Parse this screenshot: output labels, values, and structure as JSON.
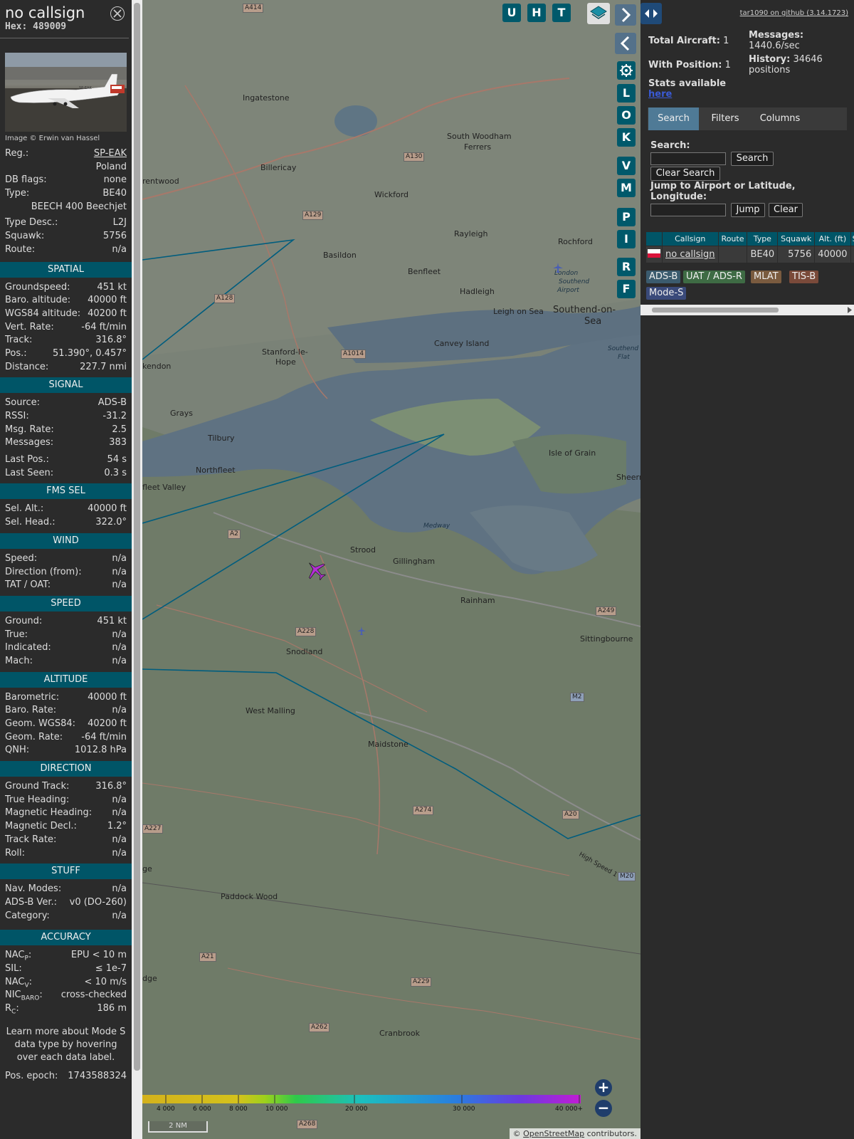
{
  "sidebar": {
    "callsign": "no callsign",
    "hex": "Hex: 489009",
    "photo_credit": "Image © Erwin van Hassel",
    "photo_reg": "SP-EAK",
    "info": [
      {
        "k": "Reg.:",
        "v": "SP-EAK",
        "link": true
      },
      {
        "k": "",
        "v": "Poland"
      },
      {
        "k": "DB flags:",
        "v": "none"
      },
      {
        "k": "Type:",
        "v": "BE40"
      },
      {
        "k": "",
        "v": "BEECH 400 Beechjet"
      },
      {
        "k": "Type Desc.:",
        "v": "L2J"
      },
      {
        "k": "Squawk:",
        "v": "5756"
      },
      {
        "k": "Route:",
        "v": "n/a"
      }
    ],
    "sections": [
      {
        "title": "SPATIAL",
        "rows": [
          {
            "k": "Groundspeed:",
            "v": "451 kt"
          },
          {
            "k": "Baro. altitude:",
            "v": "40000 ft"
          },
          {
            "k": "WGS84 altitude:",
            "v": "40200 ft"
          },
          {
            "k": "Vert. Rate:",
            "v": "-64 ft/min"
          },
          {
            "k": "Track:",
            "v": "316.8°"
          },
          {
            "k": "Pos.:",
            "v": "51.390°, 0.457°"
          },
          {
            "k": "Distance:",
            "v": "227.7 nmi"
          }
        ]
      },
      {
        "title": "SIGNAL",
        "rows": [
          {
            "k": "Source:",
            "v": "ADS-B"
          },
          {
            "k": "RSSI:",
            "v": "-31.2"
          },
          {
            "k": "Msg. Rate:",
            "v": "2.5"
          },
          {
            "k": "Messages:",
            "v": "383"
          },
          {
            "k": "Last Pos.:",
            "v": "54 s",
            "gap": true
          },
          {
            "k": "Last Seen:",
            "v": "0.3 s"
          }
        ]
      },
      {
        "title": "FMS SEL",
        "rows": [
          {
            "k": "Sel. Alt.:",
            "v": "40000 ft"
          },
          {
            "k": "Sel. Head.:",
            "v": "322.0°"
          }
        ]
      },
      {
        "title": "WIND",
        "rows": [
          {
            "k": "Speed:",
            "v": "n/a"
          },
          {
            "k": "Direction (from):",
            "v": "n/a"
          },
          {
            "k": "TAT / OAT:",
            "v": "n/a"
          }
        ]
      },
      {
        "title": "SPEED",
        "rows": [
          {
            "k": "Ground:",
            "v": "451 kt"
          },
          {
            "k": "True:",
            "v": "n/a"
          },
          {
            "k": "Indicated:",
            "v": "n/a"
          },
          {
            "k": "Mach:",
            "v": "n/a"
          }
        ]
      },
      {
        "title": "ALTITUDE",
        "rows": [
          {
            "k": "Barometric:",
            "v": "40000 ft"
          },
          {
            "k": "Baro. Rate:",
            "v": "n/a"
          },
          {
            "k": "Geom. WGS84:",
            "v": "40200 ft"
          },
          {
            "k": "Geom. Rate:",
            "v": "-64 ft/min"
          },
          {
            "k": "QNH:",
            "v": "1012.8 hPa"
          }
        ]
      },
      {
        "title": "DIRECTION",
        "rows": [
          {
            "k": "Ground Track:",
            "v": "316.8°"
          },
          {
            "k": "True Heading:",
            "v": "n/a"
          },
          {
            "k": "Magnetic Heading:",
            "v": "n/a"
          },
          {
            "k": "Magnetic Decl.:",
            "v": "1.2°"
          },
          {
            "k": "Track Rate:",
            "v": "n/a"
          },
          {
            "k": "Roll:",
            "v": "n/a"
          }
        ]
      },
      {
        "title": "STUFF",
        "rows": [
          {
            "k": "Nav. Modes:",
            "v": "n/a"
          },
          {
            "k": "ADS-B Ver.:",
            "v": "v0 (DO-260)"
          },
          {
            "k": "Category:",
            "v": "n/a"
          }
        ]
      }
    ],
    "accuracy": {
      "title": "ACCURACY",
      "nacp_k": "NAC",
      "nacp_sub": "P",
      "nacp_v": "EPU < 10 m",
      "sil_k": "SIL:",
      "sil_v": "≤ 1e-7",
      "nacv_k": "NAC",
      "nacv_sub": "V",
      "nacv_v": "< 10 m/s",
      "nic_k": "NIC",
      "nic_sub": "BARO",
      "nic_v": "cross-checked",
      "rc_k": "R",
      "rc_sub": "C",
      "rc_v": "186 m"
    },
    "note": "Learn more about Mode S data type by hovering over each data label.",
    "epoch_k": "Pos. epoch:",
    "epoch_v": "1743588324"
  },
  "map": {
    "top_buttons": [
      "U",
      "H",
      "T"
    ],
    "side_buttons": [
      "L",
      "O",
      "K",
      "V",
      "M",
      "P",
      "I",
      "R",
      "F"
    ],
    "places": [
      {
        "name": "Ingatestone"
      },
      {
        "name": "Billericay"
      },
      {
        "name": "Wickford"
      },
      {
        "name": "South Woodham"
      },
      {
        "name": "Ferrers"
      },
      {
        "name": "Rayleigh"
      },
      {
        "name": "Rochford"
      },
      {
        "name": "rentwood"
      },
      {
        "name": "Basildon"
      },
      {
        "name": "Benfleet"
      },
      {
        "name": "Hadleigh"
      },
      {
        "name": "Leigh on Sea"
      },
      {
        "name": "Southend-on-"
      },
      {
        "name": "Sea"
      },
      {
        "name": "Stanford-le-"
      },
      {
        "name": "Hope"
      },
      {
        "name": "Canvey Island"
      },
      {
        "name": "kendon"
      },
      {
        "name": "Grays"
      },
      {
        "name": "Tilbury"
      },
      {
        "name": "Northfleet"
      },
      {
        "name": "fleet Valley"
      },
      {
        "name": "Isle of Grain"
      },
      {
        "name": "Sheern"
      },
      {
        "name": "Strood"
      },
      {
        "name": "Gillingham"
      },
      {
        "name": "Rainham"
      },
      {
        "name": "Sittingbourne"
      },
      {
        "name": "Snodland"
      },
      {
        "name": "West Malling"
      },
      {
        "name": "Maidstone"
      },
      {
        "name": "Paddock Wood"
      },
      {
        "name": "Cranbrook"
      },
      {
        "name": "ge"
      },
      {
        "name": "dge"
      },
      {
        "name": "London"
      },
      {
        "name": "Southend"
      },
      {
        "name": "Airport"
      }
    ],
    "roads": [
      "A414",
      "A130",
      "A129",
      "A128",
      "A1014",
      "A2",
      "A228",
      "A249",
      "M2",
      "A274",
      "A20",
      "M20",
      "A227",
      "A21",
      "A229",
      "A262",
      "A268"
    ],
    "water_labels": [
      "Medway",
      "Southend",
      "Flat"
    ],
    "rail_label": "High Speed 1",
    "legend_labels": [
      "4 000",
      "6 000",
      "8 000",
      "10 000",
      "20 000",
      "30 000",
      "40 000+"
    ],
    "scale": "2 NM",
    "attribution_symbol": "©",
    "attribution_link": "OpenStreetMap",
    "attribution_text": "contributors."
  },
  "right": {
    "github": "tar1090 on github (3.14.1723)",
    "total_label": "Total Aircraft:",
    "total_value": "1",
    "withpos_label": "With Position:",
    "withpos_value": "1",
    "stats_label": "Stats available",
    "stats_link": "here",
    "messages_label": "Messages:",
    "messages_value": "1440.6/sec",
    "history_label": "History:",
    "history_value": "34646",
    "history_unit": "positions",
    "tabs": [
      "Search",
      "Filters",
      "Columns"
    ],
    "search_label": "Search:",
    "search_button": "Search",
    "clear_search_button": "Clear Search",
    "jump_label": "Jump to Airport or Latitude, Longitude:",
    "jump_button": "Jump",
    "clear_button": "Clear",
    "table_headers": [
      "",
      "Callsign",
      "Route",
      "Type",
      "Squawk",
      "Alt. (ft)",
      "S"
    ],
    "table_row": {
      "callsign": "no callsign",
      "route": "",
      "type": "BE40",
      "squawk": "5756",
      "alt": "40000"
    },
    "badges": [
      {
        "label": "ADS-B",
        "color": "#3b5b6e"
      },
      {
        "label": "UAT / ADS-R",
        "color": "#3e6b44"
      },
      {
        "label": "MLAT",
        "color": "#7a5b3f"
      },
      {
        "label": "TIS-B",
        "color": "#7a4a3a"
      },
      {
        "label": "Mode-S",
        "color": "#3a4a7a"
      }
    ]
  },
  "colors": {
    "section_bg": "#005567",
    "panel_bg": "#2b2b2b",
    "button_teal": "#00596b",
    "aircraft": "#b32ed6",
    "track": "#005d7e"
  }
}
